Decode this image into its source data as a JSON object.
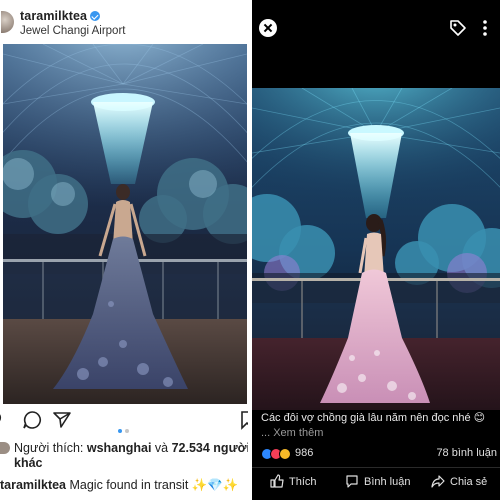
{
  "left_post": {
    "username": "taramilktea",
    "location": "Jewel Changi Airport",
    "icons": [
      "avatar",
      "verified-badge-icon",
      "comment-icon",
      "share-icon",
      "bookmark-icon"
    ],
    "carousel": {
      "count": 2,
      "active": 1
    },
    "likes_prefix": "Người thích: ",
    "likes_user": "wshanghai",
    "likes_middle": " và ",
    "likes_count": "72.534",
    "likes_suffix_1": " người",
    "likes_suffix_2": "khác",
    "caption_user": "taramilktea",
    "caption_text": " Magic found in transit ",
    "caption_emojis": "✨💎✨"
  },
  "right_viewer": {
    "icons": [
      "close-icon",
      "tag-icon",
      "more-icon",
      "like-reaction-icon",
      "love-reaction-icon",
      "wow-reaction-icon",
      "thumb-up-icon",
      "comment-bubble-icon",
      "share-arrow-icon"
    ],
    "caption": "Các đôi vợ chồng già lâu năm nên đọc nhé 😊",
    "see_more": "... Xem thêm",
    "reaction_count": "986",
    "comment_count": "78 bình luận",
    "like_label": "Thích",
    "comment_label": "Bình luận",
    "share_label": "Chia sẻ"
  },
  "colors": {
    "instagram_blue": "#3897f0",
    "facebook_blue": "#2d88ff",
    "viewer_background": "#000000",
    "photo_cyan": "#58e6ff"
  }
}
